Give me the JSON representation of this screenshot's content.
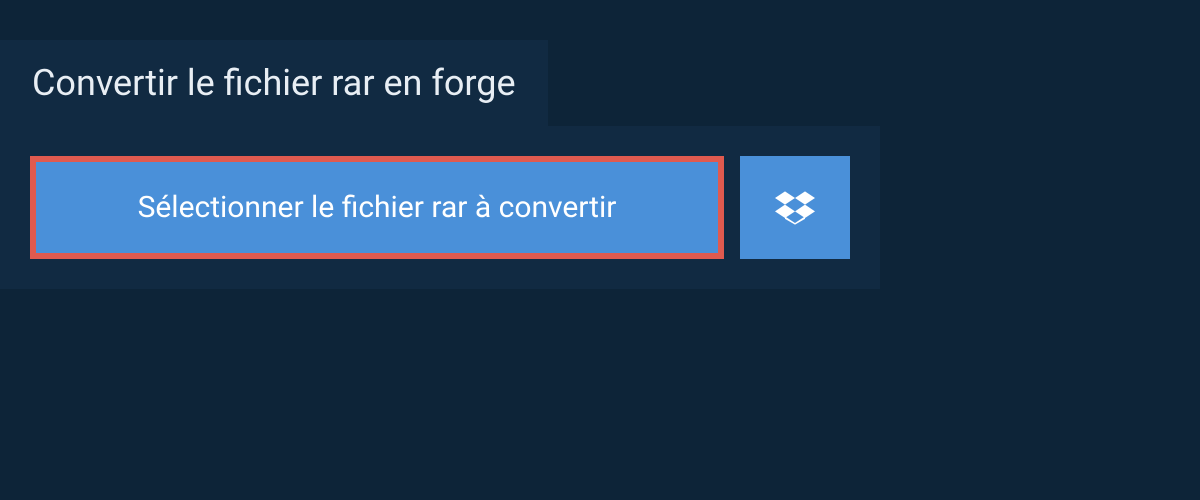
{
  "header": {
    "title": "Convertir le fichier rar en forge"
  },
  "main": {
    "select_button_label": "Sélectionner le fichier rar à convertir"
  },
  "colors": {
    "background": "#0d2438",
    "panel": "#112a42",
    "button": "#4a90d9",
    "highlight_border": "#e05a4f",
    "text_light": "#e8eef4",
    "text_white": "#ffffff"
  }
}
